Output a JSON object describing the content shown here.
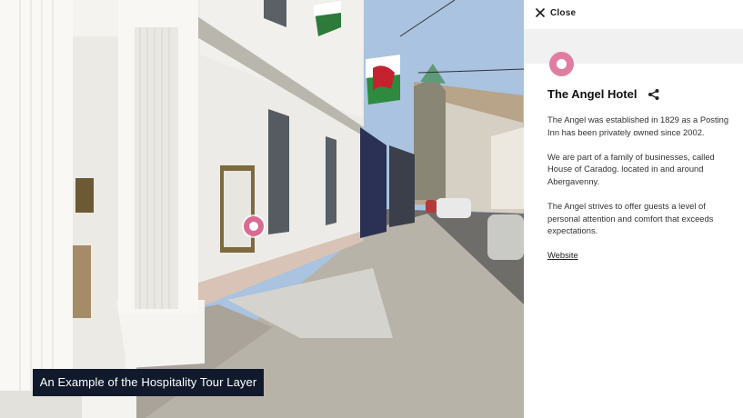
{
  "scene": {
    "caption": "An Example of the Hospitality Tour Layer"
  },
  "panel": {
    "close_label": "Close",
    "title": "The Angel Hotel",
    "paragraphs": [
      "The Angel was established in 1829 as a Posting Inn has been privately owned since 2002.",
      "We are part of a family of businesses, called House of Caradog. located in and around Abergavenny.",
      "The Angel strives to offer guests a level of personal attention and comfort that exceeds expectations."
    ],
    "link_label": "Website"
  },
  "colors": {
    "accent_pink": "#d96a93",
    "caption_bg": "#111a2c"
  }
}
